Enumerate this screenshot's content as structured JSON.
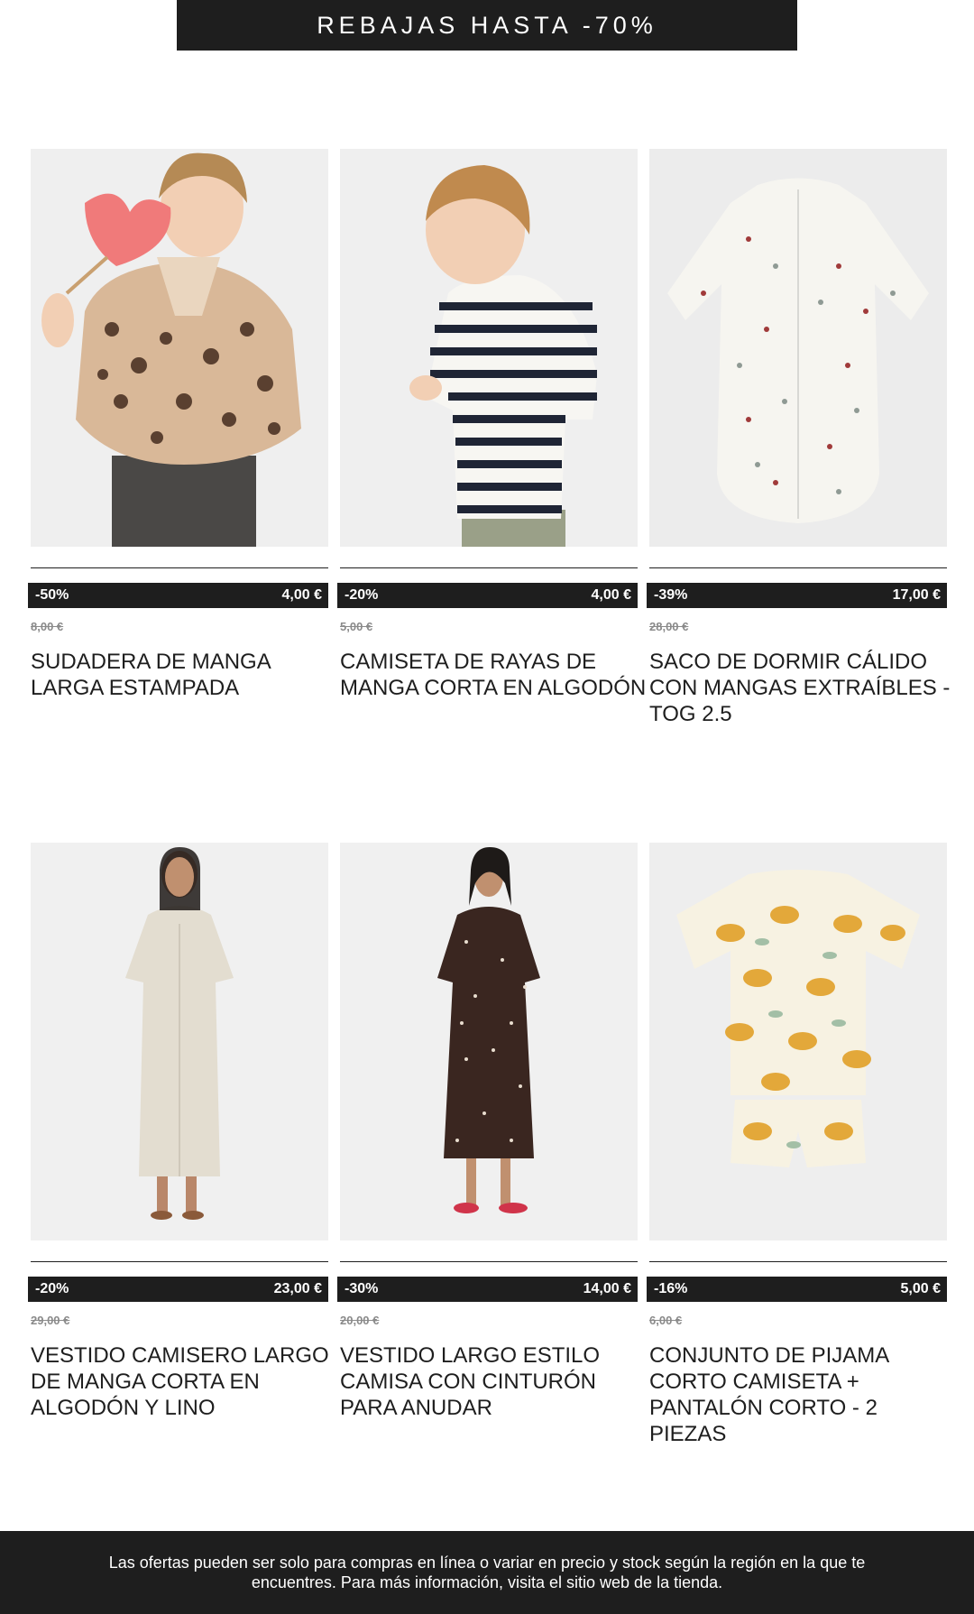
{
  "banner": {
    "text": "REBAJAS HASTA -70%"
  },
  "products": [
    {
      "discount": "-50%",
      "price": "4,00 €",
      "old_price": "8,00 €",
      "name": "SUDADERA DE MANGA LARGA ESTAMPADA",
      "image": "girl-leopard-sweatshirt-photo"
    },
    {
      "discount": "-20%",
      "price": "4,00 €",
      "old_price": "5,00 €",
      "name": "CAMISETA DE RAYAS DE MANGA CORTA EN ALGODÓN",
      "image": "boy-striped-tshirt-photo"
    },
    {
      "discount": "-39%",
      "price": "17,00 €",
      "old_price": "28,00 €",
      "name": "SACO DE DORMIR CÁLIDO CON MANGAS EXTRAÍBLES - TOG 2.5",
      "image": "baby-sleeping-bag-photo"
    },
    {
      "discount": "-20%",
      "price": "23,00 €",
      "old_price": "29,00 €",
      "name": "VESTIDO CAMISERO LARGO DE MANGA CORTA EN ALGODÓN Y LINO",
      "image": "beige-shirt-dress-photo"
    },
    {
      "discount": "-30%",
      "price": "14,00 €",
      "old_price": "20,00 €",
      "name": "VESTIDO LARGO ESTILO CAMISA CON CINTURÓN PARA ANUDAR",
      "image": "brown-dot-dress-photo"
    },
    {
      "discount": "-16%",
      "price": "5,00 €",
      "old_price": "6,00 €",
      "name": "CONJUNTO DE PIJAMA CORTO CAMISETA + PANTALÓN CORTO - 2 PIEZAS",
      "image": "leopard-pyjama-set-photo"
    }
  ],
  "footer": {
    "text": "Las ofertas pueden ser solo para compras en línea o variar en precio y stock según la región en la que te encuentres. Para más información, visita el sitio web de la tienda."
  }
}
